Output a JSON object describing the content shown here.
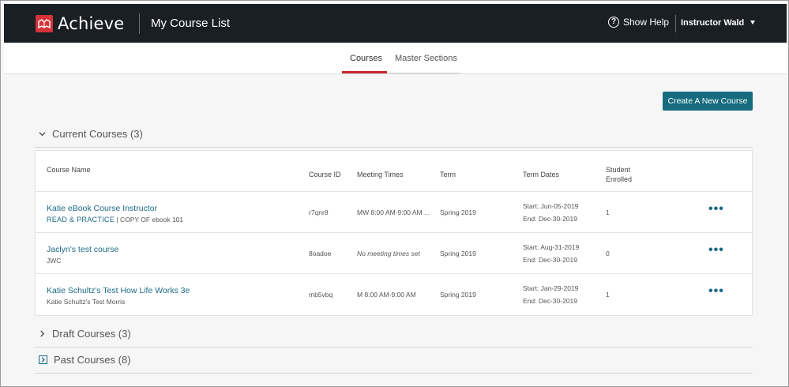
{
  "header": {
    "logo_text": "Achieve",
    "page_title": "My Course List",
    "help_label": "Show Help",
    "user_name": "Instructor Wald"
  },
  "tabs": [
    {
      "label": "Courses",
      "active": true
    },
    {
      "label": "Master Sections",
      "active": false
    }
  ],
  "create_button_label": "Create A New Course",
  "sections": {
    "current": {
      "label": "Current Courses (3)",
      "expanded": true
    },
    "draft": {
      "label": "Draft Courses (3)",
      "expanded": false
    },
    "past": {
      "label": "Past Courses (8)",
      "expanded": false
    }
  },
  "table": {
    "columns": {
      "course_name": "Course Name",
      "course_id": "Course ID",
      "meeting_times": "Meeting Times",
      "term": "Term",
      "term_dates": "Term Dates",
      "student_enrolled_1": "Student",
      "student_enrolled_2": "Enrolled"
    },
    "rows": [
      {
        "name": "Katie eBook Course Instructor",
        "sub_tag": "READ & PRACTICE",
        "sub_text": "| COPY OF ebook 101",
        "course_id": "r7qnr8",
        "meeting": "MW 8:00 AM-9:00 AM ...",
        "term": "Spring 2019",
        "start": "Start: Jun-05-2019",
        "end": "End: Dec-30-2019",
        "enrolled": "1",
        "more": "•••"
      },
      {
        "name": "Jaclyn's test course",
        "sub_tag": "",
        "sub_text": "JWC",
        "course_id": "8oadoe",
        "meeting": "No meeting times set",
        "term": "Spring 2019",
        "start": "Start: Aug-31-2019",
        "end": "End: Dec-30-2019",
        "enrolled": "0",
        "more": "•••"
      },
      {
        "name": "Katie Schultz's Test How Life Works 3e",
        "sub_tag": "",
        "sub_text": "Katie Schultz's Test Morris",
        "course_id": "mb5vbq",
        "meeting": "M 8:00 AM-9:00 AM",
        "term": "Spring 2019",
        "start": "Start: Jan-29-2019",
        "end": "End: Dec-30-2019",
        "enrolled": "1",
        "more": "•••"
      }
    ]
  },
  "colors": {
    "topbar": "#1a1f24",
    "brand_red": "#d6323a",
    "accent_teal": "#166c7e",
    "link": "#1b6a86",
    "tab_underline": "#c8292f"
  }
}
